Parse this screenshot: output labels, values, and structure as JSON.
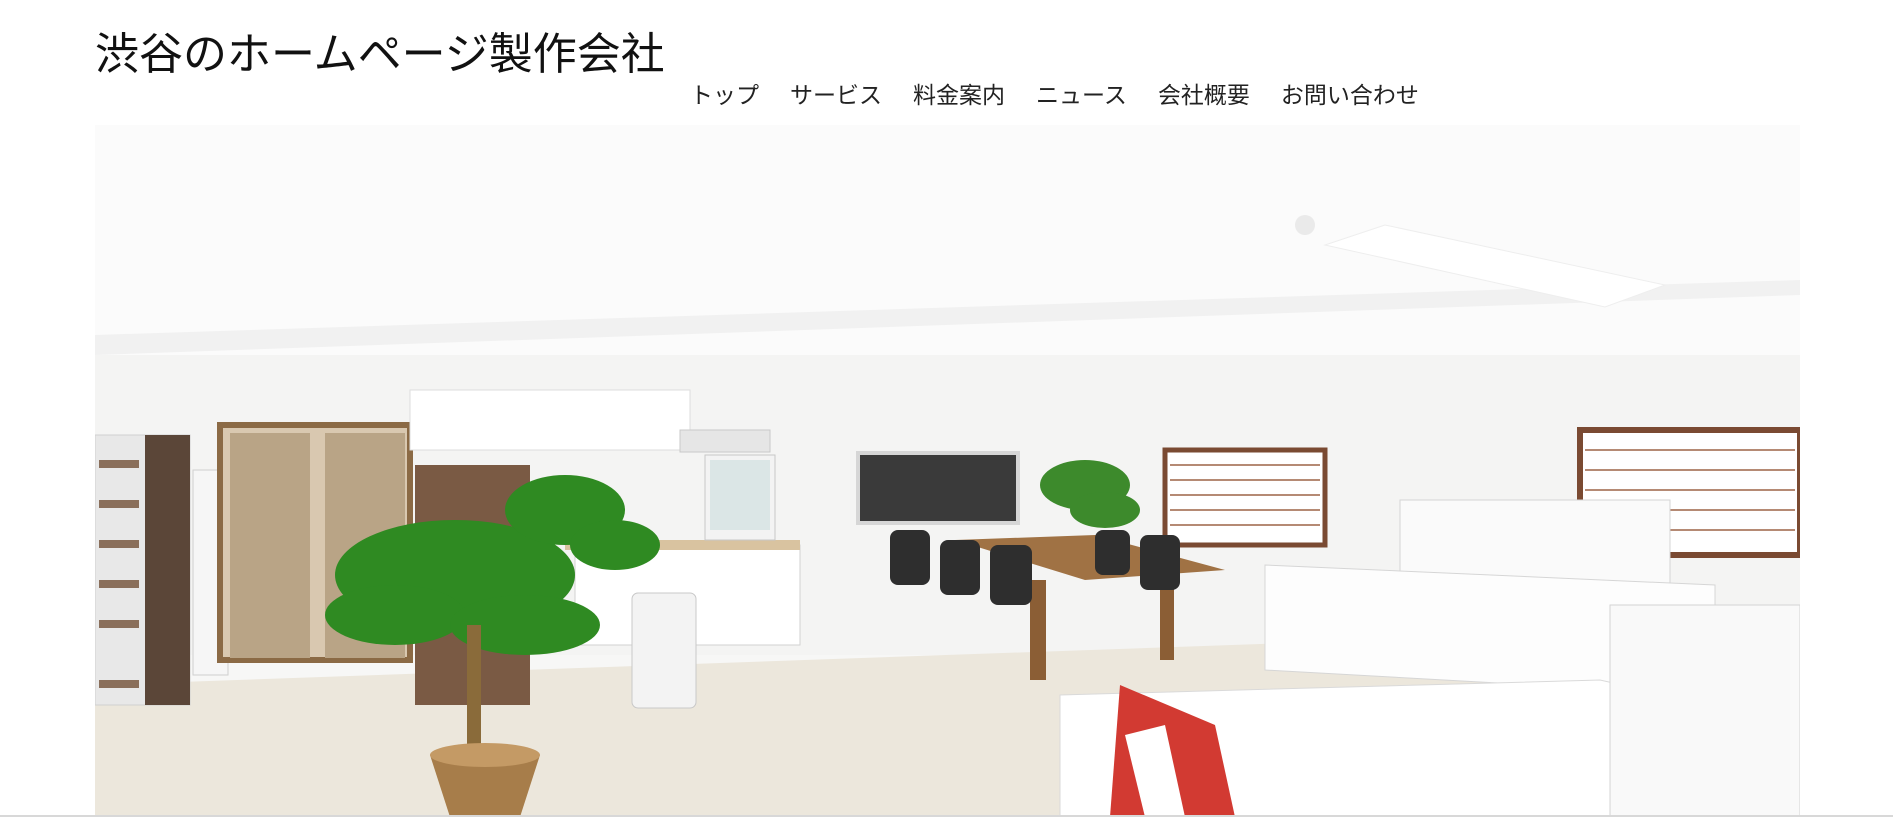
{
  "header": {
    "site_title": "渋谷のホームページ製作会社"
  },
  "nav": {
    "items": [
      {
        "label": "トップ"
      },
      {
        "label": "サービス"
      },
      {
        "label": "料金案内"
      },
      {
        "label": "ニュース"
      },
      {
        "label": "会社概要"
      },
      {
        "label": "お問い合わせ"
      }
    ]
  },
  "hero": {
    "image_name": "office-interior-photo"
  }
}
